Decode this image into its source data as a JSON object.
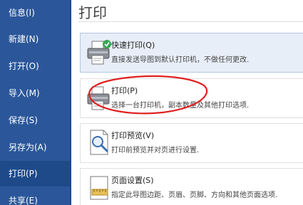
{
  "sidebar": {
    "items": [
      {
        "label": "信息(I)"
      },
      {
        "label": "新建(N)"
      },
      {
        "label": "打开(O)"
      },
      {
        "label": "导入(M)"
      },
      {
        "label": "保存(S)"
      },
      {
        "label": "另存为(A)"
      },
      {
        "label": "打印(P)"
      },
      {
        "label": "共享(E)"
      }
    ],
    "active_index": 6
  },
  "main": {
    "title": "打印",
    "options": [
      {
        "title": "快速打印(Q)",
        "description": "直接发送导图到默认打印机，不做任何更改.",
        "icon": "quick-print-icon"
      },
      {
        "title": "打印(P)",
        "description": "选择一台打印机，副本数量及其他打印选项.",
        "icon": "printer-icon"
      },
      {
        "title": "打印预览(V)",
        "description": "打印前预览并对页进行设置.",
        "icon": "print-preview-icon"
      },
      {
        "title": "页面设置(S)",
        "description": "指定此导图边距、页眉、页脚、方向和其他页面选项.",
        "icon": "page-setup-icon"
      }
    ]
  },
  "colors": {
    "sidebar_bg": "#2b579a",
    "sidebar_active": "#1e4a8a",
    "selected_option_bg": "#e8eef8",
    "annotation": "#e02020"
  }
}
